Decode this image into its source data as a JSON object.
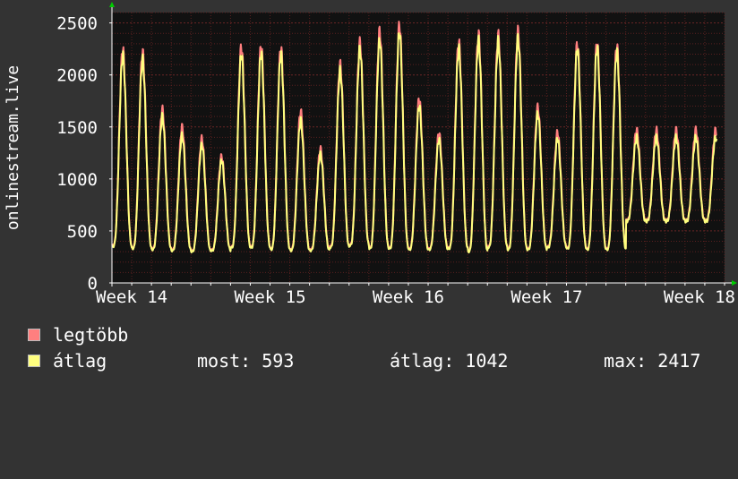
{
  "chart_data": {
    "type": "line",
    "ylabel": "onlinestream.live",
    "ylim": [
      0,
      2600
    ],
    "y_ticks": [
      0,
      500,
      1000,
      1500,
      2000,
      2500
    ],
    "x_ticks": [
      "Week 14",
      "Week 15",
      "Week 16",
      "Week 17",
      "Week 18"
    ],
    "x_tick_positions_days": [
      0,
      7,
      14,
      21,
      28
    ],
    "x_range_days": [
      -1,
      30
    ],
    "grid": true,
    "background": "#111111",
    "grid_color": "#5a2020",
    "series": [
      {
        "name": "legtöbb",
        "color": "#ff7f7f",
        "daily_peaks": [
          2250,
          2220,
          1670,
          1500,
          1390,
          1220,
          2270,
          2280,
          2260,
          1650,
          1290,
          2100,
          2310,
          2420,
          2480,
          1770,
          1440,
          2320,
          2390,
          2380,
          2420,
          1690,
          1450,
          2300,
          2310,
          2280,
          1470
        ],
        "daily_troughs": [
          360,
          340,
          330,
          320,
          310,
          320,
          350,
          350,
          330,
          320,
          320,
          350,
          370,
          340,
          340,
          330,
          330,
          340,
          310,
          350,
          330,
          330,
          350,
          340,
          330,
          330,
          600
        ]
      },
      {
        "name": "átlag",
        "color": "#ffff7f",
        "daily_peaks": [
          2190,
          2150,
          1600,
          1420,
          1330,
          1180,
          2200,
          2210,
          2200,
          1560,
          1240,
          2040,
          2250,
          2330,
          2410,
          1700,
          1380,
          2250,
          2330,
          2320,
          2350,
          1630,
          1390,
          2250,
          2260,
          2220,
          1400
        ],
        "daily_troughs": [
          350,
          330,
          320,
          310,
          300,
          310,
          340,
          340,
          320,
          310,
          310,
          340,
          360,
          330,
          330,
          320,
          320,
          330,
          300,
          340,
          320,
          320,
          340,
          330,
          320,
          320,
          593
        ]
      }
    ]
  },
  "legend": {
    "max_label": "legtöbb",
    "avg_label": "átlag",
    "now": "most: 593",
    "average": "átlag: 1042",
    "maximum": "max: 2417"
  }
}
